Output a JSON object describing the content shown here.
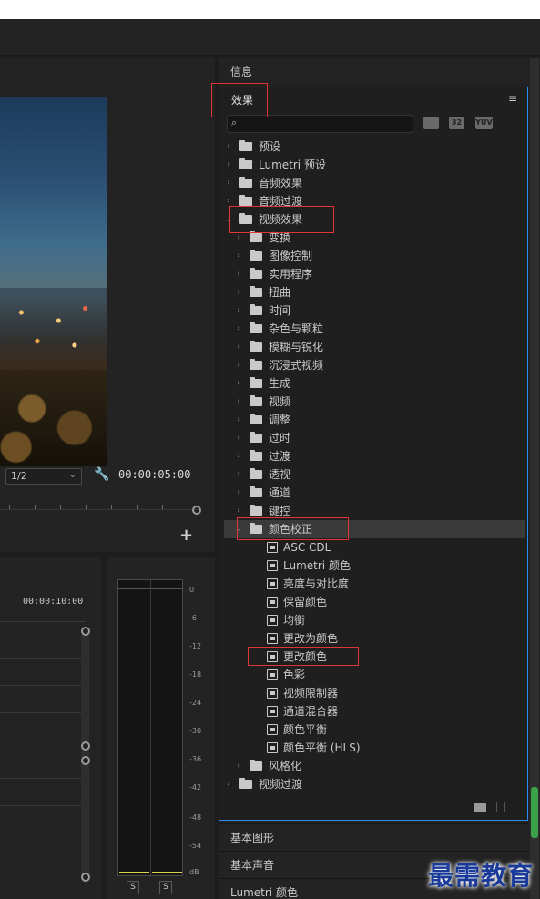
{
  "program_monitor": {
    "zoom_select": "1/2",
    "timecode": "00:00:05:00"
  },
  "timeline": {
    "timecode": "00:00:10:00"
  },
  "audio_meter": {
    "db_labels": [
      "0",
      "-6",
      "-12",
      "-18",
      "-24",
      "-30",
      "-36",
      "-42",
      "-48",
      "-54",
      "dB"
    ],
    "solo_labels": [
      "S",
      "S"
    ]
  },
  "right_panel": {
    "info_tab": "信息",
    "effects_tab": "效果",
    "menu_icon": "≡",
    "search_placeholder": "",
    "filter_buttons": [
      "32",
      "YUV"
    ],
    "tree": [
      {
        "label": "预设",
        "level": 0,
        "expanded": false,
        "icon": "preset-folder-icon"
      },
      {
        "label": "Lumetri 预设",
        "level": 0,
        "expanded": false,
        "icon": "preset-folder-icon"
      },
      {
        "label": "音频效果",
        "level": 0,
        "expanded": false,
        "icon": "folder-icon"
      },
      {
        "label": "音频过渡",
        "level": 0,
        "expanded": false,
        "icon": "folder-icon"
      },
      {
        "label": "视频效果",
        "level": 0,
        "expanded": true,
        "icon": "folder-icon"
      },
      {
        "label": "变换",
        "level": 1,
        "expanded": false,
        "icon": "folder-icon"
      },
      {
        "label": "图像控制",
        "level": 1,
        "expanded": false,
        "icon": "folder-icon"
      },
      {
        "label": "实用程序",
        "level": 1,
        "expanded": false,
        "icon": "folder-icon"
      },
      {
        "label": "扭曲",
        "level": 1,
        "expanded": false,
        "icon": "folder-icon"
      },
      {
        "label": "时间",
        "level": 1,
        "expanded": false,
        "icon": "folder-icon"
      },
      {
        "label": "杂色与颗粒",
        "level": 1,
        "expanded": false,
        "icon": "folder-icon"
      },
      {
        "label": "模糊与锐化",
        "level": 1,
        "expanded": false,
        "icon": "folder-icon"
      },
      {
        "label": "沉浸式视频",
        "level": 1,
        "expanded": false,
        "icon": "folder-icon"
      },
      {
        "label": "生成",
        "level": 1,
        "expanded": false,
        "icon": "folder-icon"
      },
      {
        "label": "视频",
        "level": 1,
        "expanded": false,
        "icon": "folder-icon"
      },
      {
        "label": "调整",
        "level": 1,
        "expanded": false,
        "icon": "folder-icon"
      },
      {
        "label": "过时",
        "level": 1,
        "expanded": false,
        "icon": "folder-icon"
      },
      {
        "label": "过渡",
        "level": 1,
        "expanded": false,
        "icon": "folder-icon"
      },
      {
        "label": "透视",
        "level": 1,
        "expanded": false,
        "icon": "folder-icon"
      },
      {
        "label": "通道",
        "level": 1,
        "expanded": false,
        "icon": "folder-icon"
      },
      {
        "label": "键控",
        "level": 1,
        "expanded": false,
        "icon": "folder-icon"
      },
      {
        "label": "颜色校正",
        "level": 1,
        "expanded": true,
        "icon": "folder-icon",
        "selected": true
      },
      {
        "label": "ASC CDL",
        "level": 2,
        "icon": "effect-icon"
      },
      {
        "label": "Lumetri 颜色",
        "level": 2,
        "icon": "effect-icon"
      },
      {
        "label": "亮度与对比度",
        "level": 2,
        "icon": "effect-icon"
      },
      {
        "label": "保留颜色",
        "level": 2,
        "icon": "effect-icon"
      },
      {
        "label": "均衡",
        "level": 2,
        "icon": "effect-icon"
      },
      {
        "label": "更改为颜色",
        "level": 2,
        "icon": "effect-icon"
      },
      {
        "label": "更改颜色",
        "level": 2,
        "icon": "effect-icon"
      },
      {
        "label": "色彩",
        "level": 2,
        "icon": "effect-icon"
      },
      {
        "label": "视频限制器",
        "level": 2,
        "icon": "effect-icon"
      },
      {
        "label": "通道混合器",
        "level": 2,
        "icon": "effect-icon"
      },
      {
        "label": "颜色平衡",
        "level": 2,
        "icon": "effect-icon"
      },
      {
        "label": "颜色平衡 (HLS)",
        "level": 2,
        "icon": "effect-icon"
      },
      {
        "label": "风格化",
        "level": 1,
        "expanded": false,
        "icon": "folder-icon"
      },
      {
        "label": "视频过渡",
        "level": 0,
        "expanded": false,
        "icon": "folder-icon"
      }
    ],
    "collapsed_tabs": [
      "基本图形",
      "基本声音",
      "Lumetri 颜色"
    ]
  },
  "watermark": "最需教育",
  "colors": {
    "accent_blue": "#2d8ceb",
    "annotation_red": "#e0343b",
    "meter_green": "#3ca24a"
  }
}
